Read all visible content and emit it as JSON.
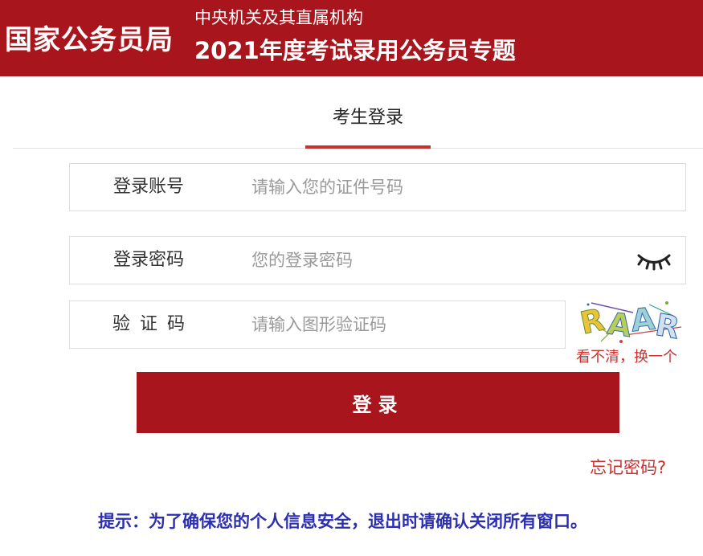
{
  "header": {
    "brand": "国家公务员局",
    "subtitle_line1": "中央机关及其直属机构",
    "subtitle_line2": "2021年度考试录用公务员专题"
  },
  "tabs": [
    {
      "label": "考生登录",
      "active": true
    }
  ],
  "form": {
    "account": {
      "label": "登录账号",
      "placeholder": "请输入您的证件号码",
      "value": ""
    },
    "password": {
      "label": "登录密码",
      "placeholder": "您的登录密码",
      "value": "",
      "toggle_icon": "eye-closed-icon"
    },
    "captcha": {
      "label": "验证码",
      "placeholder": "请输入图形验证码",
      "value": "",
      "image_text": "RAAR",
      "refresh_label": "看不清，换一个"
    },
    "submit_label": "登录",
    "forgot_label": "忘记密码?"
  },
  "tip": "提示：为了确保您的个人信息安全，退出时请确认关闭所有窗口。",
  "colors": {
    "brand_red": "#a8151d",
    "accent_red": "#c8312f",
    "tip_blue": "#2b2fb0"
  }
}
